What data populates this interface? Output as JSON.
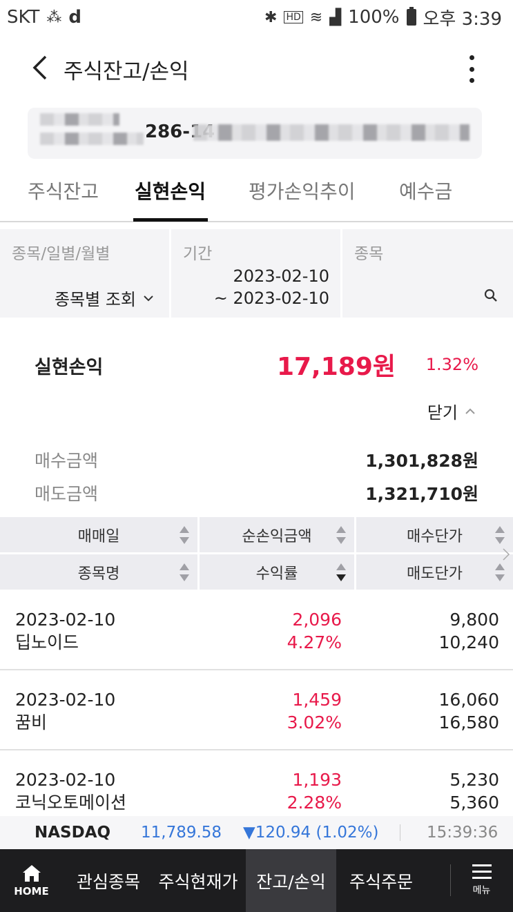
{
  "status_bar": {
    "carrier": "SKT",
    "carrier_extra": "d",
    "battery": "100%",
    "time": "오후 3:39",
    "icons": [
      "bluetooth-icon",
      "hd-voice-icon",
      "wifi-icon",
      "signal-icon",
      "battery-icon"
    ]
  },
  "header": {
    "title": "주식잔고/손익",
    "back_icon": "chevron-left-icon",
    "more_icon": "more-vertical-icon"
  },
  "account": {
    "number_visible": "286-14"
  },
  "tabs": [
    {
      "label": "주식잔고",
      "active": false
    },
    {
      "label": "실현손익",
      "active": true
    },
    {
      "label": "평가손익추이",
      "active": false
    },
    {
      "label": "예수금",
      "active": false
    }
  ],
  "filters": {
    "type_label": "종목/일별/월별",
    "type_value": "종목별 조회",
    "period_label": "기간",
    "period_from": "2023-02-10",
    "period_to": "~ 2023-02-10",
    "stock_label": "종목"
  },
  "summary": {
    "label": "실현손익",
    "value": "17,189원",
    "rate": "1.32%",
    "toggle_label": "닫기",
    "buy_amount_label": "매수금액",
    "buy_amount": "1,301,828원",
    "sell_amount_label": "매도금액",
    "sell_amount": "1,321,710원"
  },
  "table": {
    "headers_row1": [
      "매매일",
      "순손익금액",
      "매수단가"
    ],
    "headers_row2": [
      "종목명",
      "수익률",
      "매도단가"
    ],
    "rows": [
      {
        "date": "2023-02-10",
        "name": "딥노이드",
        "profit": "2,096",
        "rate": "4.27%",
        "buy_price": "9,800",
        "sell_price": "10,240"
      },
      {
        "date": "2023-02-10",
        "name": "꿈비",
        "profit": "1,459",
        "rate": "3.02%",
        "buy_price": "16,060",
        "sell_price": "16,580"
      },
      {
        "date": "2023-02-10",
        "name": "코닉오토메이션",
        "profit": "1,193",
        "rate": "2.28%",
        "buy_price": "5,230",
        "sell_price": "5,360"
      }
    ]
  },
  "ticker": {
    "name": "NASDAQ",
    "value": "11,789.58",
    "change": "▼120.94 (1.02%)",
    "time": "15:39:36"
  },
  "bottom_nav": {
    "home": "HOME",
    "items": [
      "관심종목",
      "주식현재가",
      "잔고/손익",
      "주식주문"
    ],
    "active_index": 2,
    "menu": "메뉴"
  },
  "colors": {
    "positive": "#e8194a",
    "negative": "#3576d9",
    "nav_bg": "#1d1d1f"
  }
}
